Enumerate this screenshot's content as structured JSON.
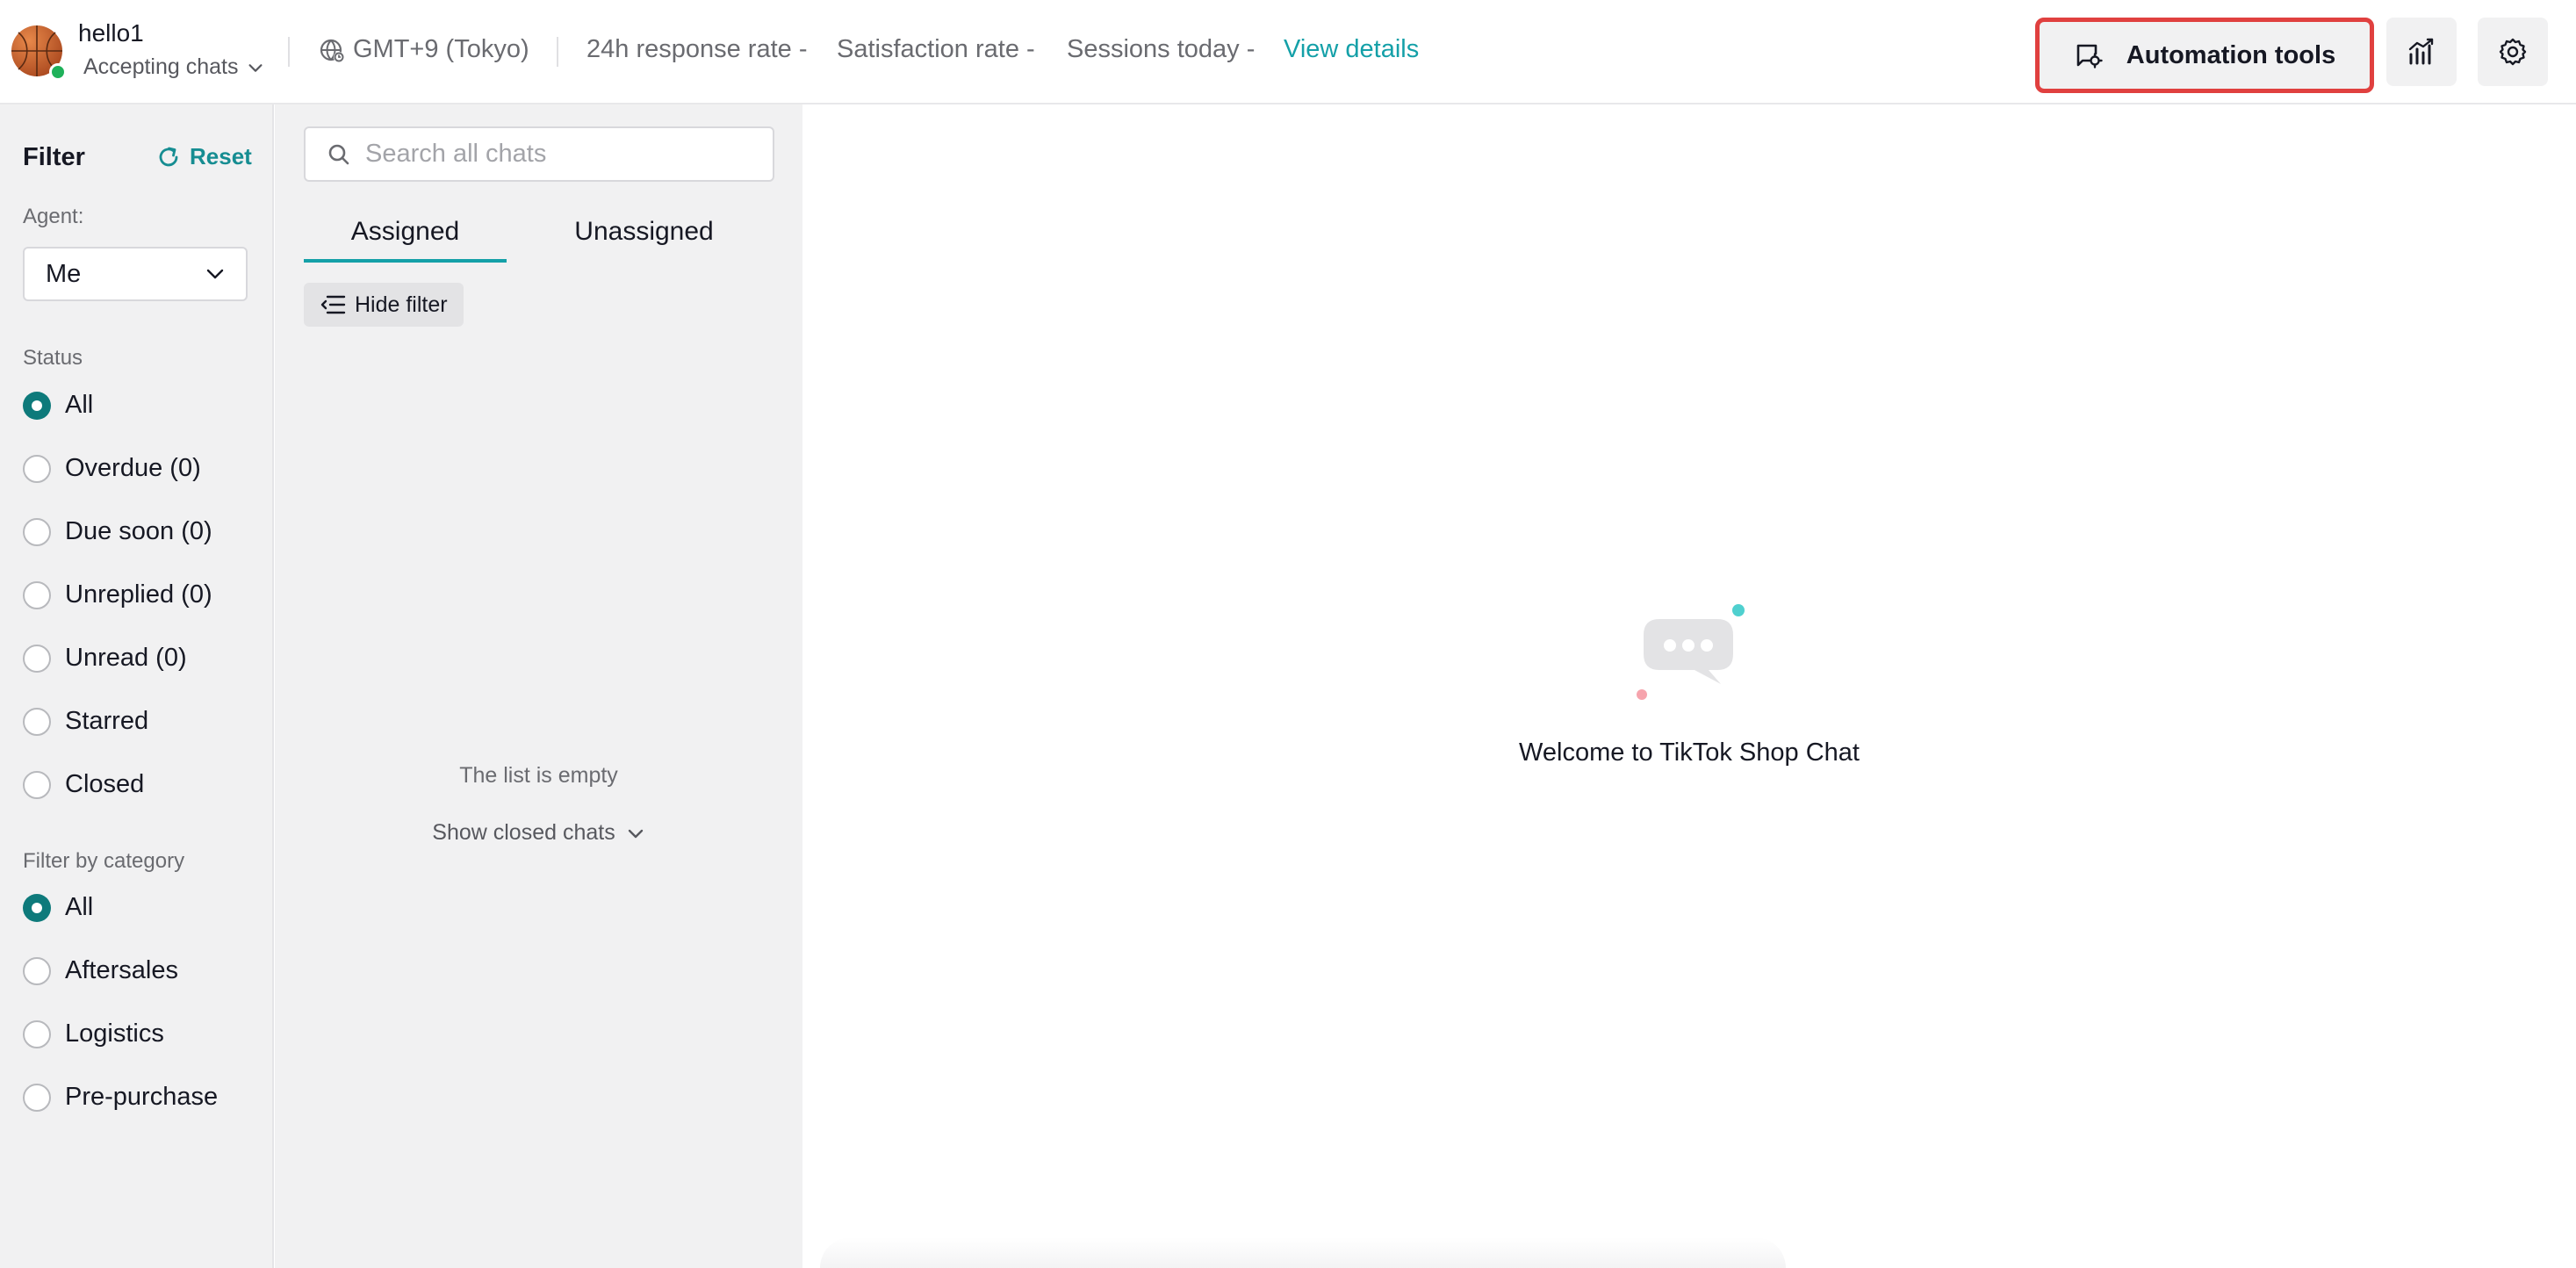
{
  "header": {
    "user_name": "hello1",
    "status": "Accepting chats",
    "timezone": "GMT+9 (Tokyo)",
    "stats": {
      "response_rate": "24h response rate -",
      "satisfaction_rate": "Satisfaction rate -",
      "sessions_today": "Sessions today -"
    },
    "view_details": "View details",
    "automation_tools": "Automation tools"
  },
  "filter": {
    "title": "Filter",
    "reset": "Reset",
    "agent_label": "Agent:",
    "agent_value": "Me",
    "status_label": "Status",
    "status_options": [
      {
        "label": "All",
        "checked": true
      },
      {
        "label": "Overdue (0)",
        "checked": false
      },
      {
        "label": "Due soon (0)",
        "checked": false
      },
      {
        "label": "Unreplied (0)",
        "checked": false
      },
      {
        "label": "Unread (0)",
        "checked": false
      },
      {
        "label": "Starred",
        "checked": false
      },
      {
        "label": "Closed",
        "checked": false
      }
    ],
    "category_label": "Filter by category",
    "category_options": [
      {
        "label": "All",
        "checked": true
      },
      {
        "label": "Aftersales",
        "checked": false
      },
      {
        "label": "Logistics",
        "checked": false
      },
      {
        "label": "Pre-purchase",
        "checked": false
      }
    ]
  },
  "chat_list": {
    "search_placeholder": "Search all chats",
    "tabs": [
      {
        "label": "Assigned",
        "active": true
      },
      {
        "label": "Unassigned",
        "active": false
      }
    ],
    "hide_filter": "Hide filter",
    "empty_text": "The list is empty",
    "show_closed": "Show closed chats"
  },
  "main": {
    "welcome": "Welcome to TikTok Shop Chat"
  },
  "colors": {
    "accent_teal": "#14a0a8",
    "radio_checked": "#0e7a7b",
    "highlight_red": "#e0403f",
    "online_green": "#1fb15a"
  },
  "icons": [
    "search-icon",
    "globe-icon",
    "chevron-down-icon",
    "refresh-icon",
    "chat-settings-icon",
    "analytics-icon",
    "gear-icon",
    "filter-lines-icon",
    "chat-bubble-icon"
  ]
}
